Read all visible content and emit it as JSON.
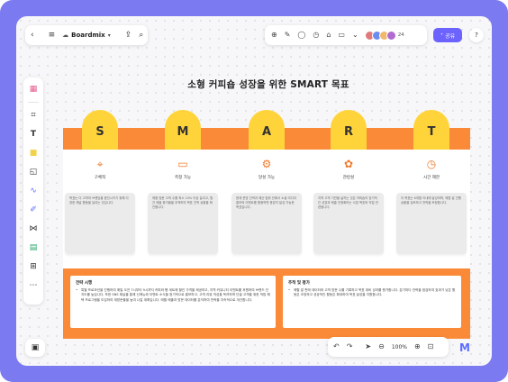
{
  "app": {
    "name": "Boardmix"
  },
  "toolbar_top_left": {
    "icons": [
      "back-icon",
      "menu-icon",
      "cloud-icon",
      "export-icon",
      "search-icon"
    ]
  },
  "toolbar_top_right": {
    "icons": [
      "add-circle-icon",
      "pen-icon",
      "comment-icon",
      "timer-icon",
      "vote-icon",
      "presentation-icon",
      "expand-icon"
    ],
    "avatars": [
      "#e07a7a",
      "#6a8cf0",
      "#f0b86a",
      "#b06ad0"
    ],
    "avatar_count": "24",
    "share_label": "공유",
    "help_label": "?"
  },
  "board": {
    "title": "소형 커피숍 성장을 위한 SMART 목표",
    "letters": [
      "S",
      "M",
      "A",
      "R",
      "T"
    ],
    "columns": [
      {
        "icon": "target-icon",
        "label": "구체적",
        "note": "목표는 더 고객의 브랜딩을 증진시키기 위해 다양한 채널 활동을 늘리는 것입니다."
      },
      {
        "icon": "ruler-icon",
        "label": "측정 가능",
        "note": "매월 방문 고객 수를 최소 10% 이상 늘리고, 월간 매출 증가율을 추적하여 목표 진척 상황을 확인합니다."
      },
      {
        "icon": "gear-icon",
        "label": "달성 가능",
        "note": "현재 운영 인력과 예산 범위 안에서 소셜 미디어 홍보와 이벤트를 활용하면 충분히 달성 가능한 목표입니다."
      },
      {
        "icon": "link-icon",
        "label": "관련성",
        "note": "지역 고객 기반을 넓히는 것은 커피숍의 장기적인 성장과 매출 안정화라는 사업 목표와 직접 관련됩니다."
      },
      {
        "icon": "clock-icon",
        "label": "시간 제한",
        "note": "이 목표는 6개월 이내에 달성하며, 매월 말 진행 상황을 검토하고 전략을 조정합니다."
      }
    ],
    "action_plan": {
      "title": "전략 시행",
      "text": "특별 프로모션을 진행하여 매일 오전 7시부터 9시까지 커피와 빵 세트에 할인 가격을 제공하고, 지역 커뮤니티 이벤트를 후원하여 브랜드 인지도를 높입니다. 또한 SNS 채널을 통해 신메뉴와 이벤트 소식을 정기적으로 홍보하고, 고객 리뷰 작성을 독려하며 단골 고객을 위한 적립 혜택 프로그램을 도입하여 재방문율을 높여 나갈 계획입니다. 매월 매출과 방문 데이터를 분석하여 전략을 지속적으로 개선합니다."
    },
    "tracking": {
      "title": "추적 및 평가",
      "text": "매월 말 판매 데이터와 고객 방문 수를 기록하고 목표 대비 성과를 평가합니다. 분기마다 전략을 점검하여 효과가 낮은 활동은 조정하고 성공적인 활동은 확대하여 목표 달성을 지원합니다."
    }
  },
  "sidebar": {
    "icons": [
      "template-icon",
      "frame-icon",
      "text-icon",
      "sticky-note-icon",
      "shape-icon",
      "connector-icon",
      "pen-icon",
      "mindmap-icon",
      "table-icon",
      "more-tools-icon",
      "more-icon"
    ]
  },
  "bottom_left": {
    "icons": [
      "minimap-icon"
    ]
  },
  "bottom_right": {
    "icons": [
      "undo-icon",
      "redo-icon",
      "cursor-icon",
      "zoom-out-icon"
    ],
    "zoom": "100%",
    "icons2": [
      "zoom-in-icon",
      "fit-icon"
    ]
  },
  "colors": {
    "accent": "#6c63ff",
    "orange": "#fa8a37",
    "yellow": "#ffd43b",
    "frame": "#7b7af0"
  }
}
